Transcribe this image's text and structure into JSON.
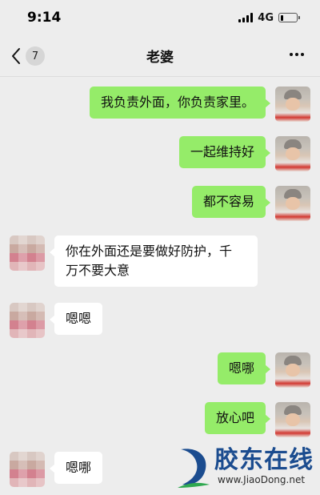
{
  "status_bar": {
    "time": "9:14",
    "network": "4G",
    "battery_level": 0.2
  },
  "nav": {
    "back_icon": "chevron-left-icon",
    "unread_count": "7",
    "title": "老婆",
    "more_icon": "more-dots-icon"
  },
  "messages": [
    {
      "from": "self",
      "text": "我负责外面，你负责家里。"
    },
    {
      "from": "self",
      "text": "一起维持好"
    },
    {
      "from": "self",
      "text": "都不容易"
    },
    {
      "from": "other",
      "text": "你在外面还是要做好防护，千\n万不要大意"
    },
    {
      "from": "other",
      "text": "嗯嗯"
    },
    {
      "from": "self",
      "text": "嗯哪"
    },
    {
      "from": "self",
      "text": "放心吧"
    },
    {
      "from": "other",
      "text": "嗯哪"
    }
  ],
  "watermark": {
    "name": "胶东在线",
    "url": "www.JiaoDong.net"
  },
  "colors": {
    "background": "#ededed",
    "bubble_self": "#95ec69",
    "bubble_other": "#ffffff",
    "watermark_blue": "#1b4c8f",
    "watermark_green": "#2fa84f"
  }
}
